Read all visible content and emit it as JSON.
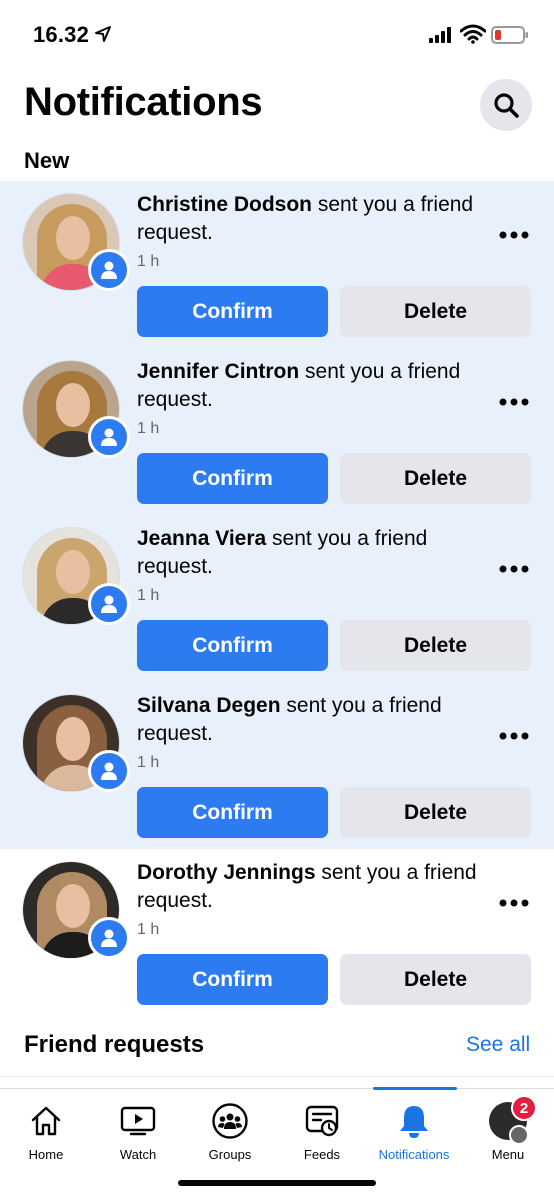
{
  "status_bar": {
    "time": "16.32",
    "icons": [
      "location-arrow-icon",
      "signal-icon",
      "wifi-icon",
      "battery-low-icon"
    ]
  },
  "header": {
    "title": "Notifications",
    "search_icon": "search-icon",
    "section_new": "New"
  },
  "notifications": [
    {
      "name": "Christine Dodson",
      "message": " sent you a friend request.",
      "time": "1 h",
      "confirm": "Confirm",
      "delete": "Delete",
      "unread": true
    },
    {
      "name": "Jennifer Cintron",
      "message": " sent you a friend request.",
      "time": "1 h",
      "confirm": "Confirm",
      "delete": "Delete",
      "unread": true
    },
    {
      "name": "Jeanna Viera",
      "message": " sent you a friend request.",
      "time": "1 h",
      "confirm": "Confirm",
      "delete": "Delete",
      "unread": true
    },
    {
      "name": "Silvana Degen",
      "message": " sent you a friend request.",
      "time": "1 h",
      "confirm": "Confirm",
      "delete": "Delete",
      "unread": true
    },
    {
      "name": "Dorothy Jennings",
      "message": " sent you a friend request.",
      "time": "1 h",
      "confirm": "Confirm",
      "delete": "Delete",
      "unread": false
    }
  ],
  "friend_requests": {
    "title": "Friend requests",
    "see_all": "See all"
  },
  "tab_bar": {
    "tabs": [
      {
        "label": "Home",
        "icon": "home-icon"
      },
      {
        "label": "Watch",
        "icon": "watch-play-icon"
      },
      {
        "label": "Groups",
        "icon": "groups-icon"
      },
      {
        "label": "Feeds",
        "icon": "feeds-icon"
      },
      {
        "label": "Notifications",
        "icon": "bell-icon",
        "active": true
      },
      {
        "label": "Menu",
        "icon": "menu-avatar-icon"
      }
    ],
    "menu_badge_count": "2"
  },
  "colors": {
    "accent": "#1b74e4",
    "confirm_button": "#2d7bf0",
    "unread_background": "#e7f0fb",
    "badge_red": "#e41e3f"
  }
}
